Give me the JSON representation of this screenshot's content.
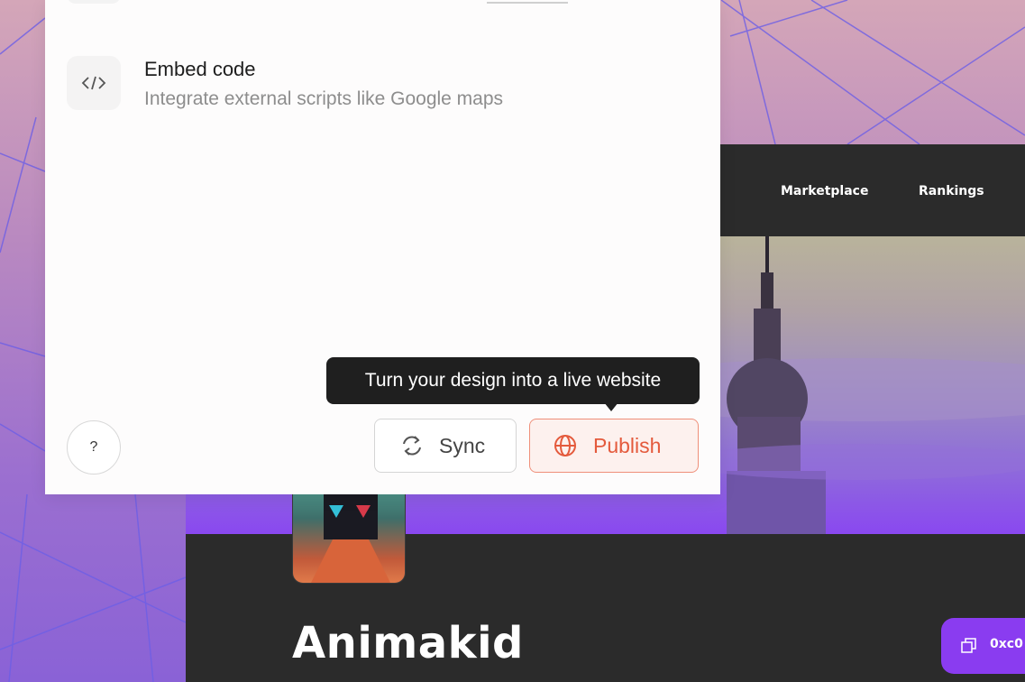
{
  "panel": {
    "menu_item": {
      "title": "Embed code",
      "description": "Integrate external scripts like Google maps",
      "icon": "code-icon"
    },
    "tooltip": "Turn your design into a live website",
    "help_label": "?",
    "sync_label": "Sync",
    "publish_label": "Publish"
  },
  "site_preview": {
    "nav_links": [
      "Marketplace",
      "Rankings"
    ],
    "title": "Animakid",
    "wallet_label": "0xc0"
  },
  "colors": {
    "publish_accent": "#e45a3c",
    "site_purple": "#8a3cf0",
    "site_dark": "#2b2b2b",
    "tooltip_bg": "#1f1f1f"
  }
}
